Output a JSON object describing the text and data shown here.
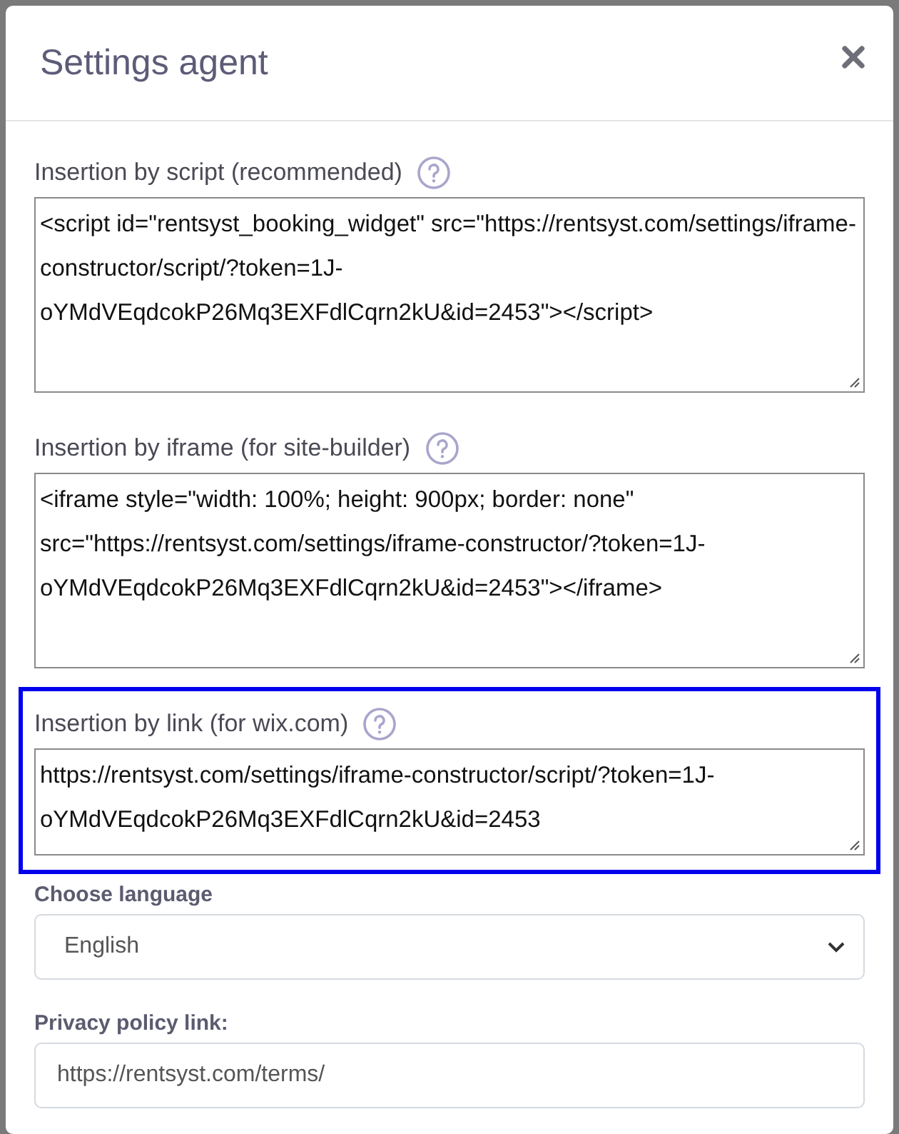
{
  "dialog": {
    "title": "Settings agent"
  },
  "fields": [
    {
      "kind": "code",
      "label": "Insertion by script (recommended)",
      "help": true,
      "highlighted": false,
      "value": "<script id=\"rentsyst_booking_widget\" src=\"https://rentsyst.com/settings/iframe-constructor/script/?token=1J-oYMdVEqdcokP26Mq3EXFdlCqrn2kU&id=2453\"></script>"
    },
    {
      "kind": "code",
      "label": "Insertion by iframe (for site-builder)",
      "help": true,
      "highlighted": false,
      "value": "<iframe style=\"width: 100%; height: 900px; border: none\" src=\"https://rentsyst.com/settings/iframe-constructor/?token=1J-oYMdVEqdcokP26Mq3EXFdlCqrn2kU&id=2453\"></iframe>"
    },
    {
      "kind": "code",
      "label": "Insertion by link (for wix.com)",
      "help": true,
      "highlighted": true,
      "value": "https://rentsyst.com/settings/iframe-constructor/script/?token=1J-oYMdVEqdcokP26Mq3EXFdlCqrn2kU&id=2453"
    },
    {
      "kind": "select",
      "label": "Choose language",
      "value": "English"
    },
    {
      "kind": "input",
      "label": "Privacy policy link:",
      "value": "https://rentsyst.com/terms/"
    }
  ]
}
